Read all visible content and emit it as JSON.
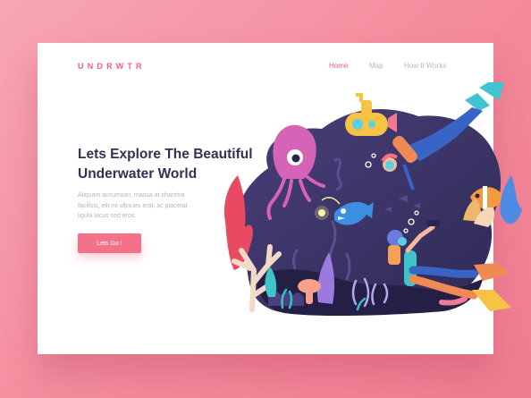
{
  "brand": {
    "logo": "UNDRWTR"
  },
  "nav": {
    "items": [
      {
        "label": "Home",
        "active": true
      },
      {
        "label": "Map",
        "active": false
      },
      {
        "label": "How It Works",
        "active": false
      }
    ]
  },
  "hero": {
    "headline_line1": "Lets Explore The Beautiful",
    "headline_line2": "Underwater World",
    "body_line1": "Aliquam accumsan, massa at pharetra",
    "body_line2": "facilisis, elit mi ultricies erat, ac placerat",
    "body_line3": "ligula lacus sed eros.",
    "cta_label": "Lets Go !"
  },
  "illustration": {
    "icons": [
      "jellyfish-icon",
      "submarine-icon",
      "diver-icon",
      "anglerfish-icon",
      "clownfish-icon",
      "coral-icon"
    ]
  },
  "colors": {
    "background": "#f48a9c",
    "accent": "#f0607a",
    "heading": "#2f3352",
    "muted_text": "#b3b6c1",
    "water": "#3b3566"
  }
}
